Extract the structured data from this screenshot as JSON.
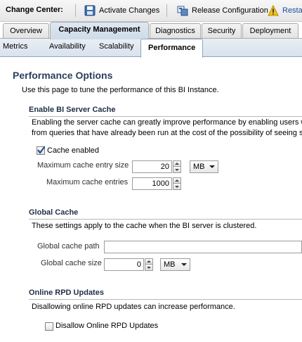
{
  "toolbar": {
    "title": "Change Center:",
    "activate_label": "Activate Changes",
    "release_label": "Release Configuration",
    "restart_label": "Resta"
  },
  "tabs": [
    {
      "label": "Overview"
    },
    {
      "label": "Capacity Management"
    },
    {
      "label": "Diagnostics"
    },
    {
      "label": "Security"
    },
    {
      "label": "Deployment"
    }
  ],
  "subtabs": [
    {
      "label": "Metrics"
    },
    {
      "label": "Availability"
    },
    {
      "label": "Scalability"
    },
    {
      "label": "Performance"
    }
  ],
  "page": {
    "title": "Performance Options",
    "intro": "Use this page to tune the performance of this BI Instance."
  },
  "server_cache": {
    "heading": "Enable BI Server Cache",
    "desc_line1": "Enabling the server cache can greatly improve performance by enabling users w",
    "desc_line2": "from queries that have already been run at the cost of the possibility of seeing s",
    "cache_enabled_label": "Cache enabled",
    "cache_enabled_checked": true,
    "max_entry_size_label": "Maximum cache entry size",
    "max_entry_size_value": "20",
    "max_entry_size_unit": "MB",
    "max_entries_label": "Maximum cache entries",
    "max_entries_value": "1000"
  },
  "global_cache": {
    "heading": "Global Cache",
    "desc": "These settings apply to the cache when the BI server is clustered.",
    "path_label": "Global cache path",
    "path_value": "",
    "size_label": "Global cache size",
    "size_value": "0",
    "size_unit": "MB"
  },
  "rpd_updates": {
    "heading": "Online RPD Updates",
    "desc": "Disallowing online RPD updates can increase performance.",
    "disallow_label": "Disallow Online RPD Updates",
    "disallow_checked": false
  }
}
